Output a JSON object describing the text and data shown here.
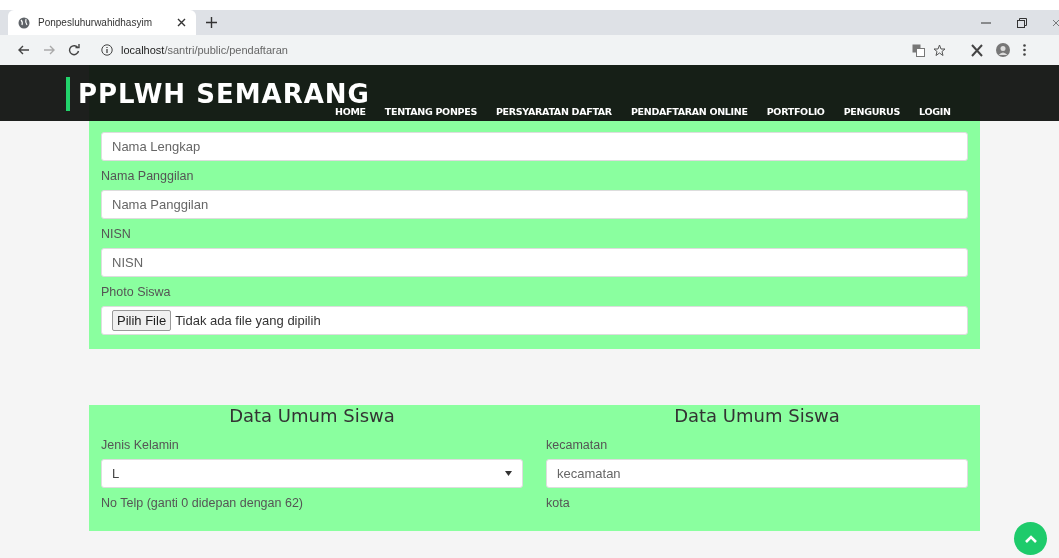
{
  "browser": {
    "tab_title": "Ponpesluhurwahidhasyim",
    "url_host": "localhost",
    "url_path": "/santri/public/pendaftaran"
  },
  "header": {
    "brand": "PPLWH SEMARANG",
    "nav": [
      "HOME",
      "TENTANG PONPES",
      "PERSYARATAN DAFTAR",
      "PENDAFTARAN ONLINE",
      "PORTFOLIO",
      "PENGURUS",
      "LOGIN"
    ]
  },
  "main_section": {
    "fields": [
      {
        "kind": "text",
        "placeholder": "Nama Lengkap"
      },
      {
        "kind": "text",
        "label": "Nama Panggilan",
        "placeholder": "Nama Panggilan"
      },
      {
        "kind": "text",
        "label": "NISN",
        "placeholder": "NISN"
      },
      {
        "kind": "file",
        "label": "Photo Siswa",
        "button": "Pilih File",
        "status": "Tidak ada file yang dipilih"
      }
    ]
  },
  "general_columns": [
    {
      "title": "Data Umum Siswa",
      "fields": [
        {
          "kind": "select",
          "label": "Jenis Kelamin",
          "value": "L"
        },
        {
          "kind": "label",
          "label": "No Telp (ganti 0 didepan dengan 62)"
        }
      ]
    },
    {
      "title": "Data Umum Siswa",
      "fields": [
        {
          "kind": "text",
          "label": "kecamatan",
          "placeholder": "kecamatan"
        },
        {
          "kind": "label",
          "label": "kota"
        }
      ]
    }
  ]
}
